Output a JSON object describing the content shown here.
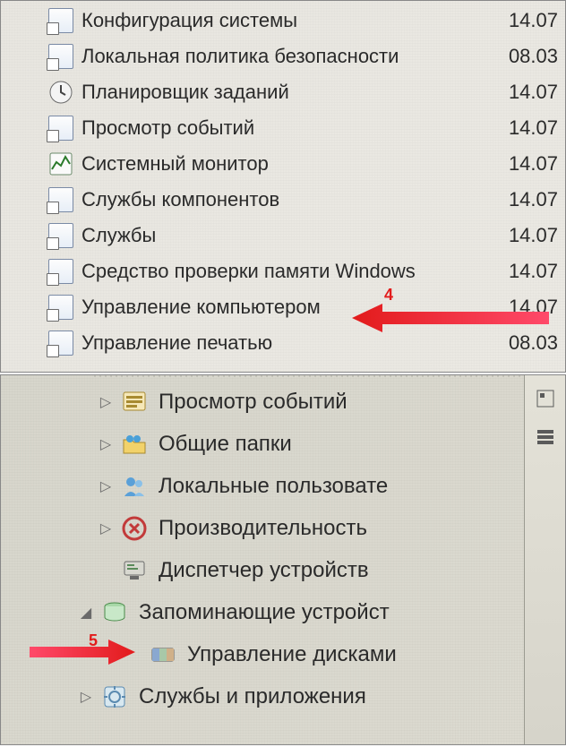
{
  "top": {
    "items": [
      {
        "label": "Конфигурация системы",
        "date": "14.07"
      },
      {
        "label": "Локальная политика безопасности",
        "date": "08.03"
      },
      {
        "label": "Планировщик заданий",
        "date": "14.07"
      },
      {
        "label": "Просмотр событий",
        "date": "14.07"
      },
      {
        "label": "Системный монитор",
        "date": "14.07"
      },
      {
        "label": "Службы компонентов",
        "date": "14.07"
      },
      {
        "label": "Службы",
        "date": "14.07"
      },
      {
        "label": "Средство проверки памяти Windows",
        "date": "14.07"
      },
      {
        "label": "Управление компьютером",
        "date": "14.07"
      },
      {
        "label": "Управление печатью",
        "date": "08.03"
      }
    ],
    "annotation": {
      "number": "4"
    }
  },
  "bottom": {
    "items": [
      {
        "label": "Просмотр событий",
        "indent": 1,
        "expander": "▷"
      },
      {
        "label": "Общие папки",
        "indent": 1,
        "expander": "▷"
      },
      {
        "label": "Локальные пользовате",
        "indent": 1,
        "expander": "▷"
      },
      {
        "label": "Производительность",
        "indent": 1,
        "expander": "▷"
      },
      {
        "label": "Диспетчер устройств",
        "indent": 1,
        "expander": ""
      },
      {
        "label": "Запоминающие устройст",
        "indent": 0,
        "expander": "◢"
      },
      {
        "label": "Управление дисками",
        "indent": 2,
        "expander": ""
      },
      {
        "label": "Службы и приложения",
        "indent": 0,
        "expander": "▷"
      }
    ],
    "annotation": {
      "number": "5"
    }
  }
}
